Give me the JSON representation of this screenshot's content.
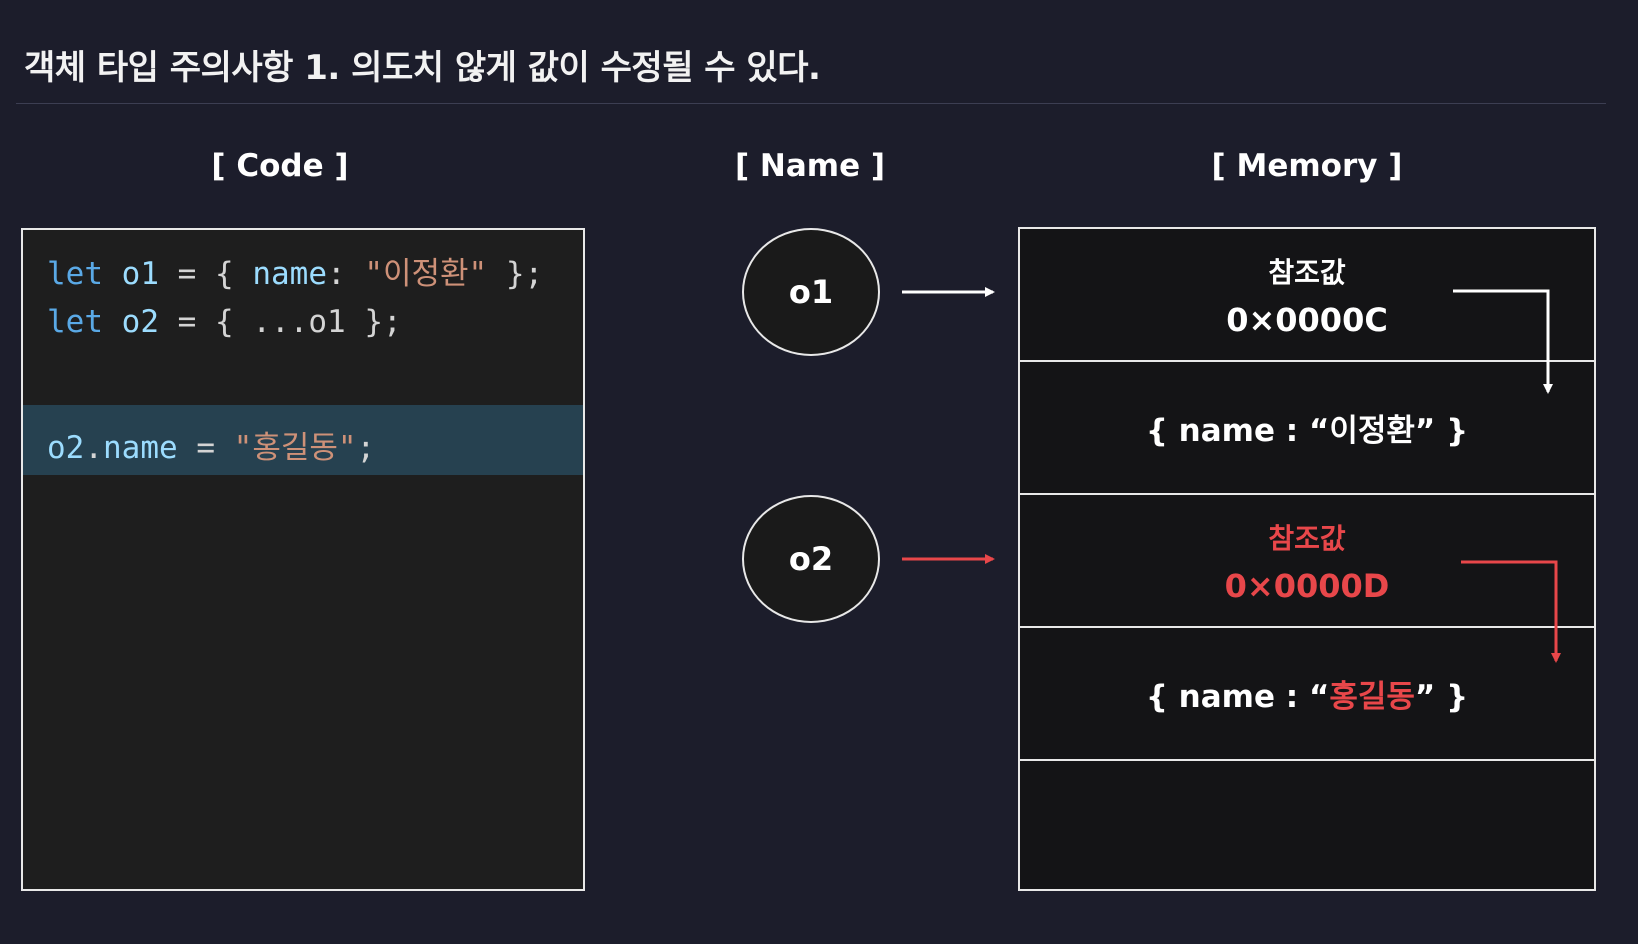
{
  "title": "객체 타입 주의사항 1.  의도치 않게 값이 수정될 수 있다.",
  "headers": {
    "code": "[ Code ]",
    "name": "[ Name ]",
    "memory": "[ Memory ]"
  },
  "code": {
    "line1": {
      "kw": "let",
      "var": "o1",
      "mid": " = { ",
      "prop": "name",
      "colon": ": ",
      "str": "\"이정환\"",
      "end": " };"
    },
    "line2": {
      "kw": "let",
      "var": "o2",
      "mid": " = { ",
      "spread": "...o1",
      "end": " };"
    },
    "line3": {
      "obj": "o2",
      "dot": ".",
      "prop": "name",
      "op": " = ",
      "str": "\"홍길동\"",
      "end": ";"
    }
  },
  "names": {
    "o1": "o1",
    "o2": "o2"
  },
  "memory": {
    "cell1": {
      "label": "참조값",
      "addr": "0×0000C"
    },
    "cell2": {
      "open": "{ name : “",
      "value": "이정환",
      "close": "” }"
    },
    "cell3": {
      "label": "참조값",
      "addr": "0×0000D"
    },
    "cell4": {
      "open": "{ name : “",
      "value": "홍길동",
      "close": "” }"
    }
  },
  "colors": {
    "background": "#1c1d2b",
    "highlight": "#e8474a",
    "white": "#ffffff"
  }
}
